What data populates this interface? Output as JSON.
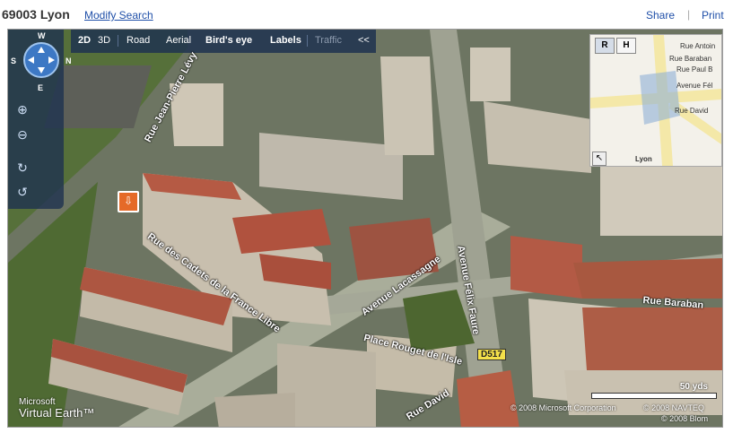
{
  "header": {
    "location": "69003 Lyon",
    "modify_search": "Modify Search",
    "share": "Share",
    "separator": "|",
    "print": "Print"
  },
  "toolbar": {
    "d2": "2D",
    "d3": "3D",
    "road": "Road",
    "aerial": "Aerial",
    "birds_eye": "Bird's eye",
    "labels": "Labels",
    "traffic": "Traffic",
    "collapse": "<<"
  },
  "compass": {
    "n": "W",
    "e": "N",
    "s": "E",
    "w": "S"
  },
  "minimap": {
    "road_btn": "R",
    "hybrid_btn": "H",
    "labels": [
      "Rue Antoin",
      "Rue Baraban",
      "Rue Paul B",
      "Avenue Fél",
      "Rue David",
      "Lyon"
    ]
  },
  "streets": {
    "jean_pierre_levy": "Rue Jean-Pierre Lévy",
    "cadets": "Rue des Cadets de la France Libre",
    "lacassagne": "Avenue Lacassagne",
    "felix_faure": "Avenue Félix Faure",
    "rouget": "Place Rouget de l'Isle",
    "baraban": "Rue Baraban",
    "david": "Rue David"
  },
  "route_shield": "D517",
  "scale": "50 yds",
  "branding": {
    "line1": "Microsoft",
    "line2": "Virtual Earth™"
  },
  "copyright": {
    "microsoft": "© 2008 Microsoft Corporation",
    "navteq": "© 2008 NAVTEQ",
    "blom": "© 2008 Blom"
  }
}
